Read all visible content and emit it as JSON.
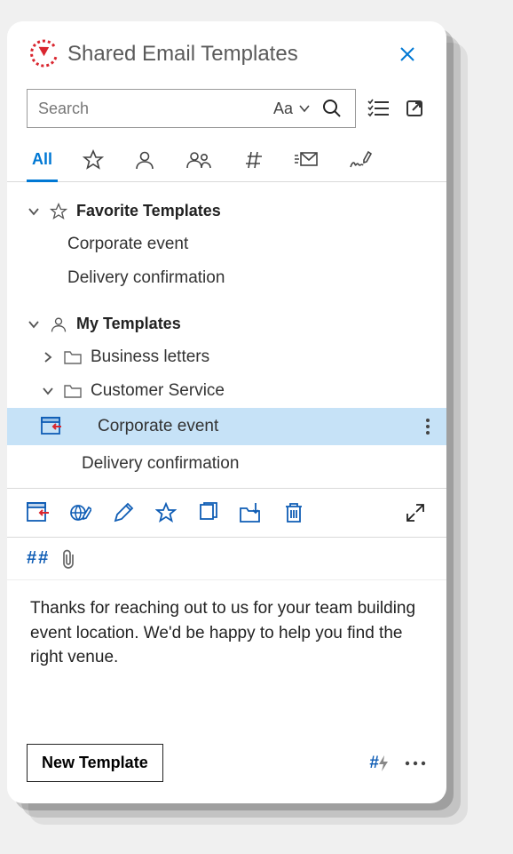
{
  "header": {
    "title": "Shared Email Templates",
    "close_label": "Close"
  },
  "search": {
    "placeholder": "Search",
    "scope_label": "Aa"
  },
  "tabs": {
    "all_label": "All"
  },
  "tree": {
    "favorites": {
      "label": "Favorite Templates",
      "items": [
        {
          "label": "Corporate event"
        },
        {
          "label": "Delivery confirmation"
        }
      ]
    },
    "my_templates": {
      "label": "My Templates",
      "folders": [
        {
          "label": "Business letters",
          "expanded": false
        },
        {
          "label": "Customer Service",
          "expanded": true,
          "templates": [
            {
              "label": "Corporate event",
              "selected": true
            },
            {
              "label": "Delivery confirmation",
              "selected": false
            }
          ]
        }
      ]
    }
  },
  "preview": {
    "hash_indicator": "##",
    "body": "Thanks for reaching out to us for your team building event location. We'd be happy to help you find the right venue."
  },
  "footer": {
    "new_button_label": "New Template"
  }
}
